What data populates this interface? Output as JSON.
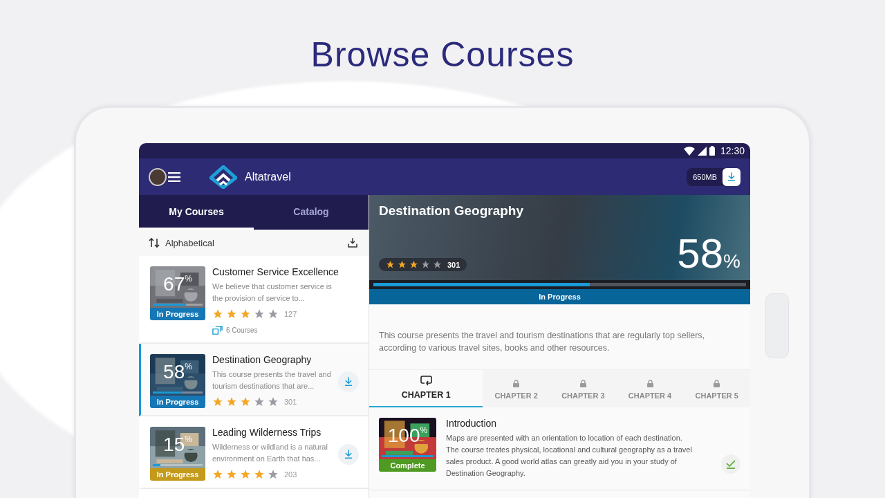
{
  "heading": "Browse Courses",
  "status_bar": {
    "time": "12:30"
  },
  "app_bar": {
    "brand": "Altatravel",
    "storage": "650MB"
  },
  "tabs": [
    {
      "label": "My Courses",
      "selected": true
    },
    {
      "label": "Catalog",
      "selected": false
    }
  ],
  "sort": {
    "label": "Alphabetical"
  },
  "courses": [
    {
      "title": "Customer Service Excellence",
      "description": "We believe that customer service is the provision of service to...",
      "percent": "67$^{%}$",
      "level": 0.67,
      "status": "In Progress",
      "color": "#1677b5",
      "stars": 3,
      "count": "127",
      "bundle": "6 Courses",
      "download": false,
      "selected": false
    },
    {
      "title": "Destination Geography",
      "description": "This course presents the travel and tourism destinations that are...",
      "percent": "58$^{%}$",
      "level": 0.58,
      "status": "In Progress",
      "color": "#1677b5",
      "stars": 3,
      "count": "301",
      "download": true,
      "selected": true
    },
    {
      "title": "Leading Wilderness Trips",
      "description": "Wilderness or wildland is a natural environment on Earth that has...",
      "percent": "15$^{%}$",
      "level": 0.15,
      "status": "In Progress",
      "color": "#c49a1a",
      "stars": 4,
      "count": "203",
      "download": true,
      "selected": false
    }
  ],
  "detail": {
    "title": "Destination Geography",
    "stars": 3,
    "count": "301",
    "percent": "58",
    "percent_sign": "%",
    "level": 0.58,
    "status": "In Progress",
    "description": "This course presents the travel and tourism destinations that are regularly top sellers, according to various travel sites, books and other resources.",
    "chapters": [
      {
        "label": "CHAPTER 1",
        "selected": true,
        "locked": false
      },
      {
        "label": "CHAPTER 2",
        "selected": false,
        "locked": true
      },
      {
        "label": "CHAPTER 3",
        "selected": false,
        "locked": true
      },
      {
        "label": "CHAPTER 4",
        "selected": false,
        "locked": true
      },
      {
        "label": "CHAPTER 5",
        "selected": false,
        "locked": true
      }
    ],
    "lessons": [
      {
        "title": "Introduction",
        "description": "Maps are presented with an orientation to location of each destination. The course treates physical, locational and cultural geography as a travel sales product. A good world atlas can greatly aid you in your study of Destination Geography.",
        "percent": "100$^{%}$",
        "level": 1,
        "status": "Complete",
        "color": "#4f9a22",
        "completed": true
      }
    ]
  }
}
